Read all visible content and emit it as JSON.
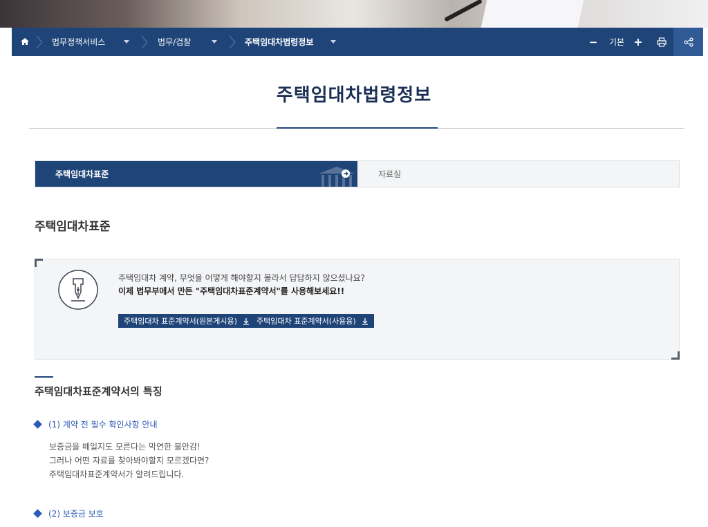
{
  "breadcrumb": {
    "items": [
      {
        "label": "법무정책서비스"
      },
      {
        "label": "법무/검찰"
      },
      {
        "label": "주택임대차법령정보"
      }
    ]
  },
  "toolbar": {
    "zoom_minus": "−",
    "zoom_label": "기본",
    "zoom_plus": "+"
  },
  "page": {
    "title": "주택임대차법령정보"
  },
  "tabs": [
    {
      "label": "주택임대차표준",
      "active": true
    },
    {
      "label": "자료실",
      "active": false
    }
  ],
  "section": {
    "title": "주택임대차표준"
  },
  "info_box": {
    "line1": "주택임대차 계약, 무엇을 어떻게 해야할지 몰라서 답답하지 않으셨나요?",
    "line2": "이제 법무부에서 만든 \"주택임대차표준계약서\"를 사용해보세요!!",
    "buttons": [
      {
        "label": "주택임대차 표준계약서(원본게시용)"
      },
      {
        "label": "주택임대차 표준계약서(사용용)"
      }
    ]
  },
  "features": {
    "title": "주택임대차표준계약서의 특징",
    "items": [
      {
        "label": "(1) 계약 전 필수 확인사항 안내",
        "lines": [
          "보증금을 떼일지도 모른다는 막연한 불안감!",
          "그러나 어떤 자료를 찾아봐야할지 모르겠다면?",
          "주택임대차표준계약서가 알려드립니다."
        ]
      },
      {
        "label": "(2) 보증금 보호",
        "lines": []
      }
    ]
  },
  "colors": {
    "navy": "#1f4478",
    "accent_blue": "#2b5bb8"
  }
}
